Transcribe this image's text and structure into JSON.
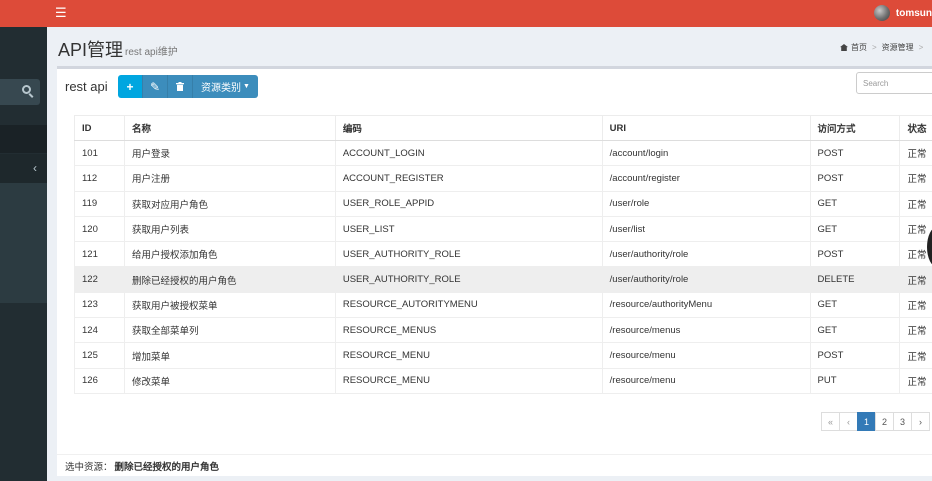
{
  "header": {
    "menu_icon": "bars-icon",
    "user_name": "tomsun"
  },
  "page": {
    "title": "API管理",
    "subtitle": "rest api维护"
  },
  "breadcrumb": [
    "首页",
    "资源管理"
  ],
  "box": {
    "title": "rest api",
    "toolbar": {
      "add_icon": "plus-icon",
      "edit_icon": "pencil-icon",
      "delete_icon": "trash-icon",
      "dropdown_label": "资源类别"
    },
    "search_placeholder": "Search"
  },
  "table": {
    "columns": [
      "ID",
      "名称",
      "编码",
      "URI",
      "访问方式",
      "状态"
    ],
    "rows": [
      [
        "101",
        "用户登录",
        "ACCOUNT_LOGIN",
        "/account/login",
        "POST",
        "正常"
      ],
      [
        "112",
        "用户注册",
        "ACCOUNT_REGISTER",
        "/account/register",
        "POST",
        "正常"
      ],
      [
        "119",
        "获取对应用户角色",
        "USER_ROLE_APPID",
        "/user/role",
        "GET",
        "正常"
      ],
      [
        "120",
        "获取用户列表",
        "USER_LIST",
        "/user/list",
        "GET",
        "正常"
      ],
      [
        "121",
        "给用户授权添加角色",
        "USER_AUTHORITY_ROLE",
        "/user/authority/role",
        "POST",
        "正常"
      ],
      [
        "122",
        "删除已经授权的用户角色",
        "USER_AUTHORITY_ROLE",
        "/user/authority/role",
        "DELETE",
        "正常"
      ],
      [
        "123",
        "获取用户被授权菜单",
        "RESOURCE_AUTORITYMENU",
        "/resource/authorityMenu",
        "GET",
        "正常"
      ],
      [
        "124",
        "获取全部菜单列",
        "RESOURCE_MENUS",
        "/resource/menus",
        "GET",
        "正常"
      ],
      [
        "125",
        "增加菜单",
        "RESOURCE_MENU",
        "/resource/menu",
        "POST",
        "正常"
      ],
      [
        "126",
        "修改菜单",
        "RESOURCE_MENU",
        "/resource/menu",
        "PUT",
        "正常"
      ]
    ],
    "selected_row_index": 5
  },
  "pagination": [
    "«",
    "‹",
    "1",
    "2",
    "3",
    "›"
  ],
  "pagination_active": "1",
  "selection": {
    "label": "选中资源：",
    "value": "删除已经授权的用户角色"
  }
}
